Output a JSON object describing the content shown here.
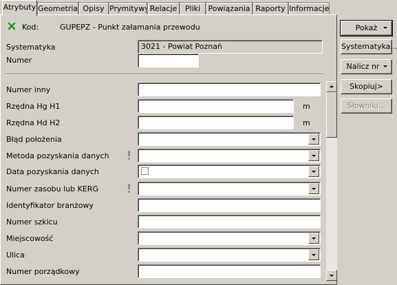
{
  "tabs": [
    "Atrybuty",
    "Geometria",
    "Opisy",
    "Prymitywy",
    "Relacje",
    "Pliki",
    "Powiązania",
    "Raporty",
    "Informacje"
  ],
  "active_tab": "Atrybuty",
  "header": {
    "status_icon": "close-x-icon",
    "status_color": "#1a8a1a",
    "kod_label": "Kod:",
    "kod_value": "GUPEPZ - Punkt załamania przewodu"
  },
  "top_fields": {
    "systematyka_label": "Systematyka",
    "systematyka_value": "3021 - Powiat Poznań",
    "numer_label": "Numer",
    "numer_value": ""
  },
  "fields": [
    {
      "label": "Numer inny",
      "type": "text",
      "value": ""
    },
    {
      "label": "Rzędna Hg H1",
      "type": "text",
      "value": "",
      "unit": "m"
    },
    {
      "label": "Rzędna Hd H2",
      "type": "text",
      "value": "",
      "unit": "m"
    },
    {
      "label": "Błąd położenia",
      "type": "combo",
      "value": ""
    },
    {
      "label": "Metoda pozyskania danych",
      "type": "combo",
      "value": "",
      "required": true
    },
    {
      "label": "Data pozyskania danych",
      "type": "date-combo",
      "value": ""
    },
    {
      "label": "Numer zasobu lub KERG",
      "type": "combo",
      "value": "",
      "required": true
    },
    {
      "label": "Identyfikator branżowy",
      "type": "text",
      "value": ""
    },
    {
      "label": "Numer szkicu",
      "type": "text",
      "value": ""
    },
    {
      "label": "Miejscowość",
      "type": "combo",
      "value": ""
    },
    {
      "label": "Ulica",
      "type": "combo",
      "value": ""
    },
    {
      "label": "Numer porządkowy",
      "type": "text",
      "value": ""
    }
  ],
  "buttons": {
    "pokaz": "Pokaż",
    "systematyka": "Systematyka...",
    "nalicz": "Nalicz nr",
    "skopiuj": "Skopiuj>",
    "slowniki": "Słowniki..."
  }
}
